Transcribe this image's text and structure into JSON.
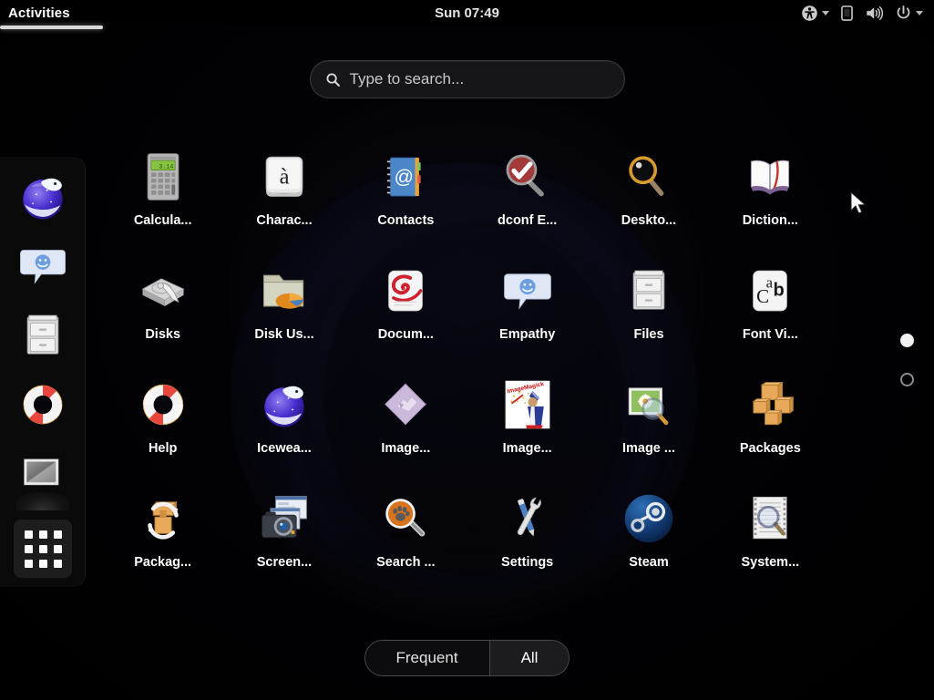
{
  "topbar": {
    "activities_label": "Activities",
    "clock": "Sun 07:49",
    "icons": {
      "accessibility": "accessibility-icon",
      "display": "display-icon",
      "volume": "volume-icon",
      "power": "power-icon"
    }
  },
  "search": {
    "placeholder": "Type to search...",
    "value": "",
    "icon": "search-icon"
  },
  "dash": {
    "items": [
      {
        "name": "iceweasel",
        "label": "Iceweasel",
        "running": false
      },
      {
        "name": "empathy",
        "label": "Empathy",
        "running": false
      },
      {
        "name": "files",
        "label": "Files",
        "running": false
      },
      {
        "name": "help",
        "label": "Help",
        "running": false
      },
      {
        "name": "image-viewer",
        "label": "Image Viewer",
        "running": true
      }
    ],
    "grid_button": "show-applications-icon"
  },
  "apps": [
    {
      "label": "Calcula...",
      "icon": "calculator-icon"
    },
    {
      "label": "Charac...",
      "icon": "character-map-icon"
    },
    {
      "label": "Contacts",
      "icon": "contacts-icon"
    },
    {
      "label": "dconf E...",
      "icon": "dconf-editor-icon"
    },
    {
      "label": "Deskto...",
      "icon": "desktop-search-icon"
    },
    {
      "label": "Diction...",
      "icon": "dictionary-icon"
    },
    {
      "label": "Disks",
      "icon": "disks-icon"
    },
    {
      "label": "Disk Us...",
      "icon": "disk-usage-analyzer-icon"
    },
    {
      "label": "Docum...",
      "icon": "documents-icon"
    },
    {
      "label": "Empathy",
      "icon": "empathy-icon"
    },
    {
      "label": "Files",
      "icon": "files-icon"
    },
    {
      "label": "Font Vi...",
      "icon": "font-viewer-icon"
    },
    {
      "label": "Help",
      "icon": "help-icon"
    },
    {
      "label": "Icewea...",
      "icon": "iceweasel-icon"
    },
    {
      "label": "Image...",
      "icon": "imagemagick-display-icon"
    },
    {
      "label": "Image...",
      "icon": "imagemagick-wizard-icon"
    },
    {
      "label": "Image ...",
      "icon": "image-viewer-icon"
    },
    {
      "label": "Packages",
      "icon": "packages-icon"
    },
    {
      "label": "Packag...",
      "icon": "package-update-icon"
    },
    {
      "label": "Screen...",
      "icon": "screenshot-icon"
    },
    {
      "label": "Search ...",
      "icon": "search-tool-icon"
    },
    {
      "label": "Settings",
      "icon": "settings-icon"
    },
    {
      "label": "Steam",
      "icon": "steam-icon"
    },
    {
      "label": "System...",
      "icon": "system-log-icon"
    }
  ],
  "pages": {
    "count": 2,
    "active": 1
  },
  "view_toggle": {
    "frequent_label": "Frequent",
    "all_label": "All",
    "selected": "All"
  },
  "calculator_display": "3.14",
  "colors": {
    "topbar_bg": "#000000",
    "dash_bg": "#0a0a0a",
    "accent_text": "#ffffff",
    "wallpaper_core": "#11122a",
    "selected_seg": "#1c1c1f"
  }
}
